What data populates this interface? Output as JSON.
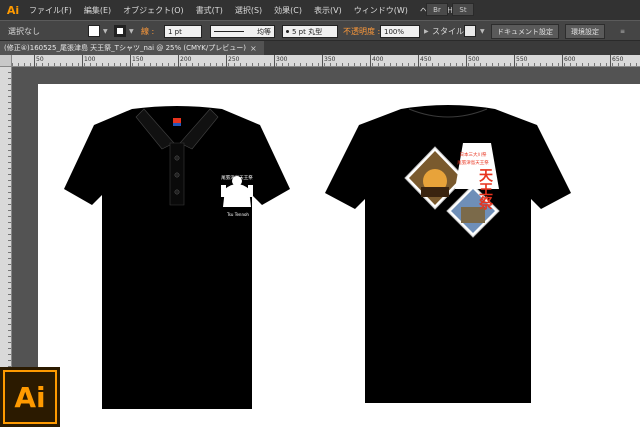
{
  "app": {
    "logo": "Ai"
  },
  "menu": {
    "items": [
      "ファイル(F)",
      "編集(E)",
      "オブジェクト(O)",
      "書式(T)",
      "選択(S)",
      "効果(C)",
      "表示(V)",
      "ウィンドウ(W)",
      "ヘルプ(H)"
    ],
    "right_buttons": [
      "Br",
      "St"
    ]
  },
  "control": {
    "selection_label": "選択なし",
    "stroke_label": "線 :",
    "stroke_width": "1 pt",
    "stroke_profile": "均等",
    "brush": "5 pt 丸型",
    "opacity_label": "不透明度 :",
    "opacity_value": "100%",
    "style_label": "スタイル :",
    "doc_settings": "ドキュメント設定",
    "prefs": "環境設定"
  },
  "document_tab": {
    "title": "(修正④)160525_尾張津島 天王祭_Tシャツ_nai @ 25% (CMYK/プレビュー)",
    "close": "×"
  },
  "ruler_ticks": [
    "50",
    "100",
    "150",
    "200",
    "250",
    "300",
    "350",
    "400",
    "450",
    "500",
    "550",
    "600",
    "650"
  ],
  "artwork": {
    "front_print": {
      "script": "尾張津島天王祭",
      "caption": "Tsu Tennoh"
    },
    "back_print": {
      "title": "天王祭",
      "header_lines": [
        "日本三大川祭",
        "尾張津島天王祭"
      ]
    }
  },
  "colors": {
    "accent": "#ff9a00",
    "shirt": "#000000",
    "print_red": "#e8331e",
    "artboard": "#ffffff",
    "panel": "#454545"
  },
  "badge": {
    "text": "Ai"
  }
}
